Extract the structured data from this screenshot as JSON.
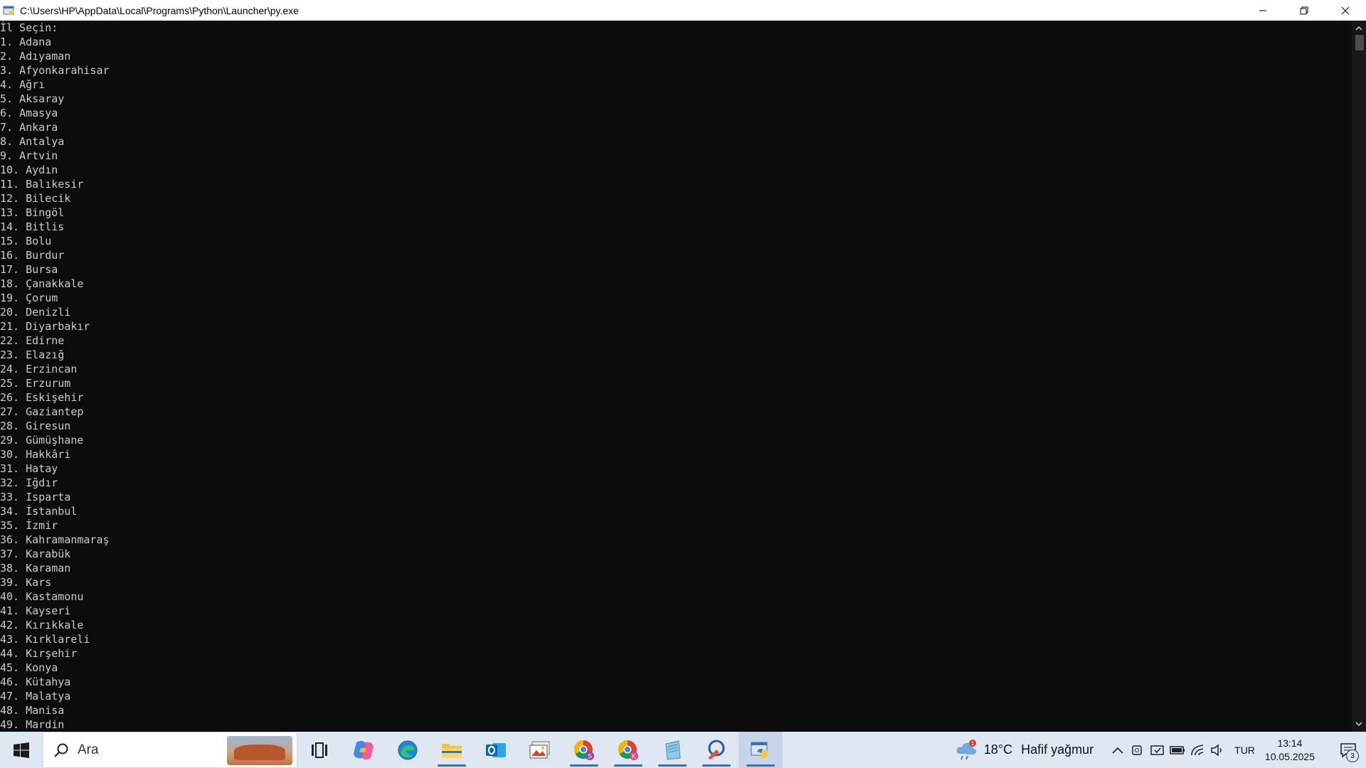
{
  "window": {
    "title": "C:\\Users\\HP\\AppData\\Local\\Programs\\Python\\Launcher\\py.exe"
  },
  "console": {
    "header": "İl Seçin:",
    "lines": [
      "1. Adana",
      "2. Adıyaman",
      "3. Afyonkarahisar",
      "4. Ağrı",
      "5. Aksaray",
      "6. Amasya",
      "7. Ankara",
      "8. Antalya",
      "9. Artvin",
      "10. Aydın",
      "11. Balıkesir",
      "12. Bilecik",
      "13. Bingöl",
      "14. Bitlis",
      "15. Bolu",
      "16. Burdur",
      "17. Bursa",
      "18. Çanakkale",
      "19. Çorum",
      "20. Denizli",
      "21. Diyarbakır",
      "22. Edirne",
      "23. Elazığ",
      "24. Erzincan",
      "25. Erzurum",
      "26. Eskişehir",
      "27. Gaziantep",
      "28. Giresun",
      "29. Gümüşhane",
      "30. Hakkâri",
      "31. Hatay",
      "32. Iğdır",
      "33. Isparta",
      "34. İstanbul",
      "35. İzmir",
      "36. Kahramanmaraş",
      "37. Karabük",
      "38. Karaman",
      "39. Kars",
      "40. Kastamonu",
      "41. Kayseri",
      "42. Kırıkkale",
      "43. Kırklareli",
      "44. Kırşehir",
      "45. Konya",
      "46. Kütahya",
      "47. Malatya",
      "48. Manisa",
      "49. Mardin"
    ]
  },
  "taskbar": {
    "search_label": "Ara",
    "apps": [
      {
        "name": "task-view-icon"
      },
      {
        "name": "copilot-icon"
      },
      {
        "name": "edge-icon"
      },
      {
        "name": "file-explorer-icon"
      },
      {
        "name": "outlook-icon"
      },
      {
        "name": "photos-icon"
      },
      {
        "name": "chrome-profile-s-icon",
        "badge": "S"
      },
      {
        "name": "chrome-profile-k-icon",
        "badge": "K"
      },
      {
        "name": "notepad-icon"
      },
      {
        "name": "pen-app-icon"
      },
      {
        "name": "python-launcher-icon"
      }
    ],
    "weather": {
      "badge": "1",
      "temp": "18°C",
      "condition": "Hafif yağmur"
    },
    "language": "TUR",
    "time": "13:14",
    "date": "10.05.2025",
    "notifications": "3"
  },
  "colors": {
    "console_bg": "#0c0c0c",
    "console_text": "#cccccc",
    "taskbar_bg": "#dfe8f2",
    "accent": "#2f72c6"
  }
}
